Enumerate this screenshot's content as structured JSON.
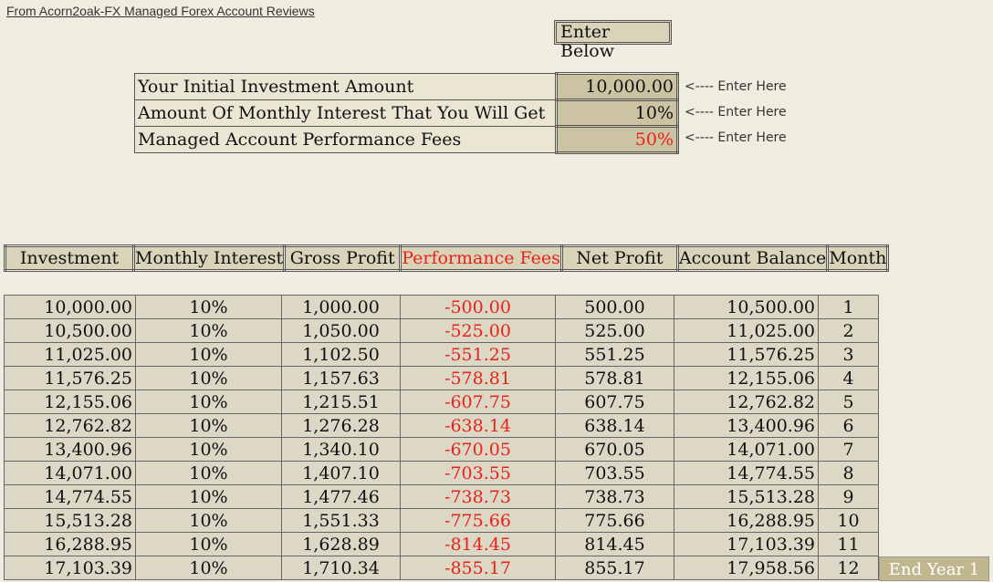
{
  "source_link": "From Acorn2oak-FX Managed Forex Account Reviews",
  "enter_below": "Enter Below",
  "inputs": [
    {
      "label": "Your Initial Investment Amount",
      "value": "10,000.00",
      "hint": "<---- Enter Here"
    },
    {
      "label": "Amount Of Monthly Interest That You Will Get",
      "value": "10%",
      "hint": "<---- Enter Here"
    },
    {
      "label": "Managed Account Performance Fees",
      "value": "50%",
      "hint": "<---- Enter Here"
    }
  ],
  "columns": [
    "Investment",
    "Monthly Interest",
    "Gross Profit",
    "Performance Fees",
    "Net Profit",
    "Account Balance",
    "Month"
  ],
  "rows": [
    [
      "10,000.00",
      "10%",
      "1,000.00",
      "-500.00",
      "500.00",
      "10,500.00",
      "1"
    ],
    [
      "10,500.00",
      "10%",
      "1,050.00",
      "-525.00",
      "525.00",
      "11,025.00",
      "2"
    ],
    [
      "11,025.00",
      "10%",
      "1,102.50",
      "-551.25",
      "551.25",
      "11,576.25",
      "3"
    ],
    [
      "11,576.25",
      "10%",
      "1,157.63",
      "-578.81",
      "578.81",
      "12,155.06",
      "4"
    ],
    [
      "12,155.06",
      "10%",
      "1,215.51",
      "-607.75",
      "607.75",
      "12,762.82",
      "5"
    ],
    [
      "12,762.82",
      "10%",
      "1,276.28",
      "-638.14",
      "638.14",
      "13,400.96",
      "6"
    ],
    [
      "13,400.96",
      "10%",
      "1,340.10",
      "-670.05",
      "670.05",
      "14,071.00",
      "7"
    ],
    [
      "14,071.00",
      "10%",
      "1,407.10",
      "-703.55",
      "703.55",
      "14,774.55",
      "8"
    ],
    [
      "14,774.55",
      "10%",
      "1,477.46",
      "-738.73",
      "738.73",
      "15,513.28",
      "9"
    ],
    [
      "15,513.28",
      "10%",
      "1,551.33",
      "-775.66",
      "775.66",
      "16,288.95",
      "10"
    ],
    [
      "16,288.95",
      "10%",
      "1,628.89",
      "-814.45",
      "814.45",
      "17,103.39",
      "11"
    ],
    [
      "17,103.39",
      "10%",
      "1,710.34",
      "-855.17",
      "855.17",
      "17,958.56",
      "12"
    ]
  ],
  "end_year": "End Year 1",
  "colors": {
    "background": "#efece0",
    "header": "#d9d3b9",
    "input_cell": "#cbc3a2",
    "fee_red": "#e8231a",
    "end_year_bg": "#c0b78f"
  }
}
